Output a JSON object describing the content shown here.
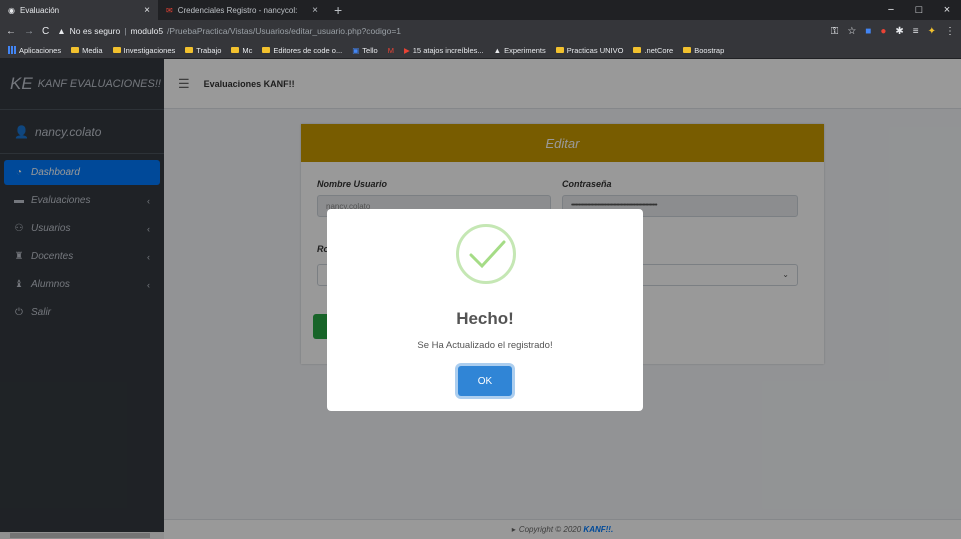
{
  "browser": {
    "tabs": [
      {
        "title": "Evaluación",
        "active": true
      },
      {
        "title": "Credenciales Registro - nancycol:",
        "active": false
      }
    ],
    "url_insecure": "No es seguro",
    "url_host": "modulo5",
    "url_path": "/PruebaPractica/Vistas/Usuarios/editar_usuario.php?codigo=1",
    "bookmarks": [
      "Aplicaciones",
      "Media",
      "Investigaciones",
      "Trabajo",
      "Mc",
      "Editores de code o...",
      "Tello",
      "15 atajos increíbles...",
      "Experiments",
      "Practicas UNIVO",
      ".netCore",
      "Boostrap"
    ]
  },
  "sidebar": {
    "brand_logo": "KE",
    "brand_name": "KANF EVALUACIONES!!",
    "user": "nancy.colato",
    "items": [
      {
        "label": "Dashboard",
        "icon": "dashboard-icon",
        "active": true
      },
      {
        "label": "Evaluaciones",
        "icon": "folder-icon"
      },
      {
        "label": "Usuarios",
        "icon": "users-icon"
      },
      {
        "label": "Docentes",
        "icon": "teacher-icon"
      },
      {
        "label": "Alumnos",
        "icon": "student-icon"
      },
      {
        "label": "Salir",
        "icon": "power-icon"
      }
    ]
  },
  "header": {
    "title": "Evaluaciones KANF!!"
  },
  "card": {
    "title": "Editar",
    "username_label": "Nombre Usuario",
    "username_value": "nancy.colato",
    "password_label": "Contraseña",
    "password_value": "•••••••••••••••••••••••••••••••••••••••••••••••••••••••••••",
    "role_label": "Ro"
  },
  "footer": {
    "text": "Copyright © 2020",
    "brand": "KANF!!."
  },
  "modal": {
    "title": "Hecho!",
    "message": "Se Ha Actualizado el registrado!",
    "ok_label": "OK"
  },
  "colors": {
    "accent": "#007bff",
    "header": "#c99a00",
    "sidebar": "#343a40",
    "ok": "#3085d6"
  }
}
